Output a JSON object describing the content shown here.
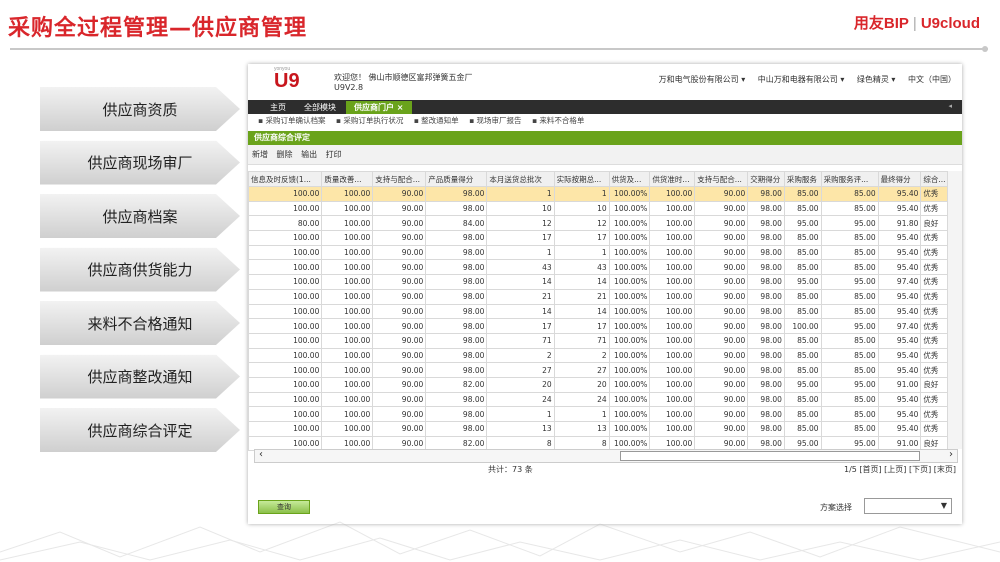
{
  "slide_title": "采购全过程管理—供应商管理",
  "brand": {
    "bip": "用友BIP",
    "sep": "|",
    "cloud": "U9cloud"
  },
  "nav": [
    "供应商资质",
    "供应商现场审厂",
    "供应商档案",
    "供应商供货能力",
    "来料不合格通知",
    "供应商整改通知",
    "供应商综合评定"
  ],
  "app": {
    "logo_small": "yonyou",
    "logo": "U9",
    "welcome": "欢迎您！ 佛山市顺德区富邦弹簧五金厂",
    "version": "U9V2.8",
    "top_right": [
      "万和电气股份有限公司 ▾",
      "中山万和电器有限公司 ▾",
      "绿色精灵 ▾",
      "中文（中国）"
    ],
    "tabs": [
      "主页",
      "全部模块",
      "供应商门户"
    ],
    "tab_close": "×",
    "links": [
      "▪ 采购订单确认档案",
      "▪ 采购订单执行状况",
      "▪ 整改通知单",
      "▪ 现场审厂报告",
      "▪ 来料不合格单"
    ],
    "section": "供应商综合评定",
    "toolbar": [
      "新增",
      "删除",
      "输出",
      "打印"
    ],
    "columns": [
      "信息及时反馈(1...",
      "质量改善...",
      "支持与配合...",
      "产品质量得分",
      "本月送货总批次",
      "实际按期总...",
      "供货及...",
      "供货准时...",
      "支持与配合...",
      "交期得分",
      "采购服务",
      "采购服务评...",
      "最终得分",
      "综合..."
    ],
    "rows": [
      [
        "100.00",
        "100.00",
        "90.00",
        "98.00",
        "1",
        "1",
        "100.00%",
        "100.00",
        "90.00",
        "98.00",
        "85.00",
        "85.00",
        "95.40",
        "优秀"
      ],
      [
        "100.00",
        "100.00",
        "90.00",
        "98.00",
        "10",
        "10",
        "100.00%",
        "100.00",
        "90.00",
        "98.00",
        "85.00",
        "85.00",
        "95.40",
        "优秀"
      ],
      [
        "80.00",
        "100.00",
        "90.00",
        "84.00",
        "12",
        "12",
        "100.00%",
        "100.00",
        "90.00",
        "98.00",
        "95.00",
        "95.00",
        "91.80",
        "良好"
      ],
      [
        "100.00",
        "100.00",
        "90.00",
        "98.00",
        "17",
        "17",
        "100.00%",
        "100.00",
        "90.00",
        "98.00",
        "85.00",
        "85.00",
        "95.40",
        "优秀"
      ],
      [
        "100.00",
        "100.00",
        "90.00",
        "98.00",
        "1",
        "1",
        "100.00%",
        "100.00",
        "90.00",
        "98.00",
        "85.00",
        "85.00",
        "95.40",
        "优秀"
      ],
      [
        "100.00",
        "100.00",
        "90.00",
        "98.00",
        "43",
        "43",
        "100.00%",
        "100.00",
        "90.00",
        "98.00",
        "85.00",
        "85.00",
        "95.40",
        "优秀"
      ],
      [
        "100.00",
        "100.00",
        "90.00",
        "98.00",
        "14",
        "14",
        "100.00%",
        "100.00",
        "90.00",
        "98.00",
        "95.00",
        "95.00",
        "97.40",
        "优秀"
      ],
      [
        "100.00",
        "100.00",
        "90.00",
        "98.00",
        "21",
        "21",
        "100.00%",
        "100.00",
        "90.00",
        "98.00",
        "85.00",
        "85.00",
        "95.40",
        "优秀"
      ],
      [
        "100.00",
        "100.00",
        "90.00",
        "98.00",
        "14",
        "14",
        "100.00%",
        "100.00",
        "90.00",
        "98.00",
        "85.00",
        "85.00",
        "95.40",
        "优秀"
      ],
      [
        "100.00",
        "100.00",
        "90.00",
        "98.00",
        "17",
        "17",
        "100.00%",
        "100.00",
        "90.00",
        "98.00",
        "100.00",
        "95.00",
        "97.40",
        "优秀"
      ],
      [
        "100.00",
        "100.00",
        "90.00",
        "98.00",
        "71",
        "71",
        "100.00%",
        "100.00",
        "90.00",
        "98.00",
        "85.00",
        "85.00",
        "95.40",
        "优秀"
      ],
      [
        "100.00",
        "100.00",
        "90.00",
        "98.00",
        "2",
        "2",
        "100.00%",
        "100.00",
        "90.00",
        "98.00",
        "85.00",
        "85.00",
        "95.40",
        "优秀"
      ],
      [
        "100.00",
        "100.00",
        "90.00",
        "98.00",
        "27",
        "27",
        "100.00%",
        "100.00",
        "90.00",
        "98.00",
        "85.00",
        "85.00",
        "95.40",
        "优秀"
      ],
      [
        "100.00",
        "100.00",
        "90.00",
        "82.00",
        "20",
        "20",
        "100.00%",
        "100.00",
        "90.00",
        "98.00",
        "95.00",
        "95.00",
        "91.00",
        "良好"
      ],
      [
        "100.00",
        "100.00",
        "90.00",
        "98.00",
        "24",
        "24",
        "100.00%",
        "100.00",
        "90.00",
        "98.00",
        "85.00",
        "85.00",
        "95.40",
        "优秀"
      ],
      [
        "100.00",
        "100.00",
        "90.00",
        "98.00",
        "1",
        "1",
        "100.00%",
        "100.00",
        "90.00",
        "98.00",
        "85.00",
        "85.00",
        "95.40",
        "优秀"
      ],
      [
        "100.00",
        "100.00",
        "90.00",
        "98.00",
        "13",
        "13",
        "100.00%",
        "100.00",
        "90.00",
        "98.00",
        "85.00",
        "85.00",
        "95.40",
        "优秀"
      ],
      [
        "100.00",
        "100.00",
        "90.00",
        "82.00",
        "8",
        "8",
        "100.00%",
        "100.00",
        "90.00",
        "98.00",
        "95.00",
        "95.00",
        "91.00",
        "良好"
      ]
    ],
    "total": "共计：73 条",
    "pager": "1/5 [首页] [上页] [下页] [末页]",
    "query": "查询",
    "scheme_label": "方案选择",
    "scheme_arrow": "▼"
  },
  "colors": {
    "accent": "#d9262b",
    "green": "#6aa31b",
    "selected_row": "#fde6a8"
  }
}
